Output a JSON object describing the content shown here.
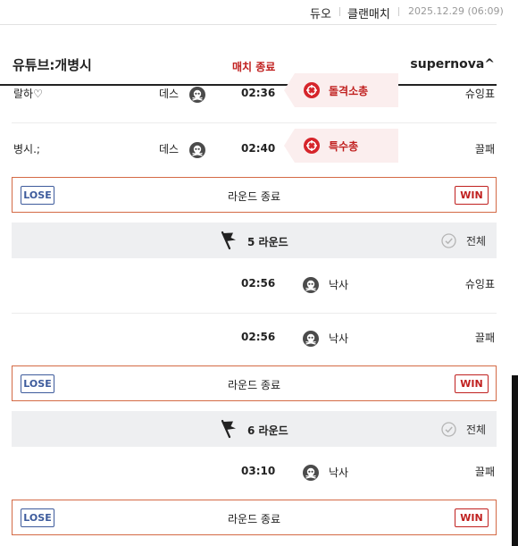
{
  "header": {
    "mode_duo": "듀오",
    "mode_clan": "클랜매치",
    "date": "2025.12.29 (06:09)"
  },
  "match": {
    "team_a": "유튜브:개병시",
    "result": "매치 종료",
    "team_b": "supernova^"
  },
  "kills_round4": [
    {
      "victim": "랄하♡",
      "cause": "데스",
      "time": "02:36",
      "weapon": "돌격소총",
      "killer": "슈잉표"
    },
    {
      "victim": "병시.;",
      "cause": "데스",
      "time": "02:40",
      "weapon": "특수총",
      "killer": "끌패"
    }
  ],
  "round_end": {
    "lose": "LOSE",
    "label": "라운드 종료",
    "win": "WIN"
  },
  "round5": {
    "title": "5 라운드",
    "all": "전체",
    "events": [
      {
        "time": "02:56",
        "cause": "낙사",
        "player": "슈잉표"
      },
      {
        "time": "02:56",
        "cause": "낙사",
        "player": "끌패"
      }
    ]
  },
  "round6": {
    "title": "6 라운드",
    "all": "전체",
    "events": [
      {
        "time": "03:10",
        "cause": "낙사",
        "player": "끌패"
      }
    ]
  },
  "icons": {
    "death": "skull-icon",
    "weapon": "crosshair-icon",
    "round": "flag-icon",
    "all": "check-circle-icon"
  },
  "colors": {
    "accent_red": "#c0201f",
    "lose_blue": "#3d5b9c",
    "end_border": "#d46a45",
    "weapon_bg": "#fbeeee",
    "round_bg": "#eeeff1"
  }
}
